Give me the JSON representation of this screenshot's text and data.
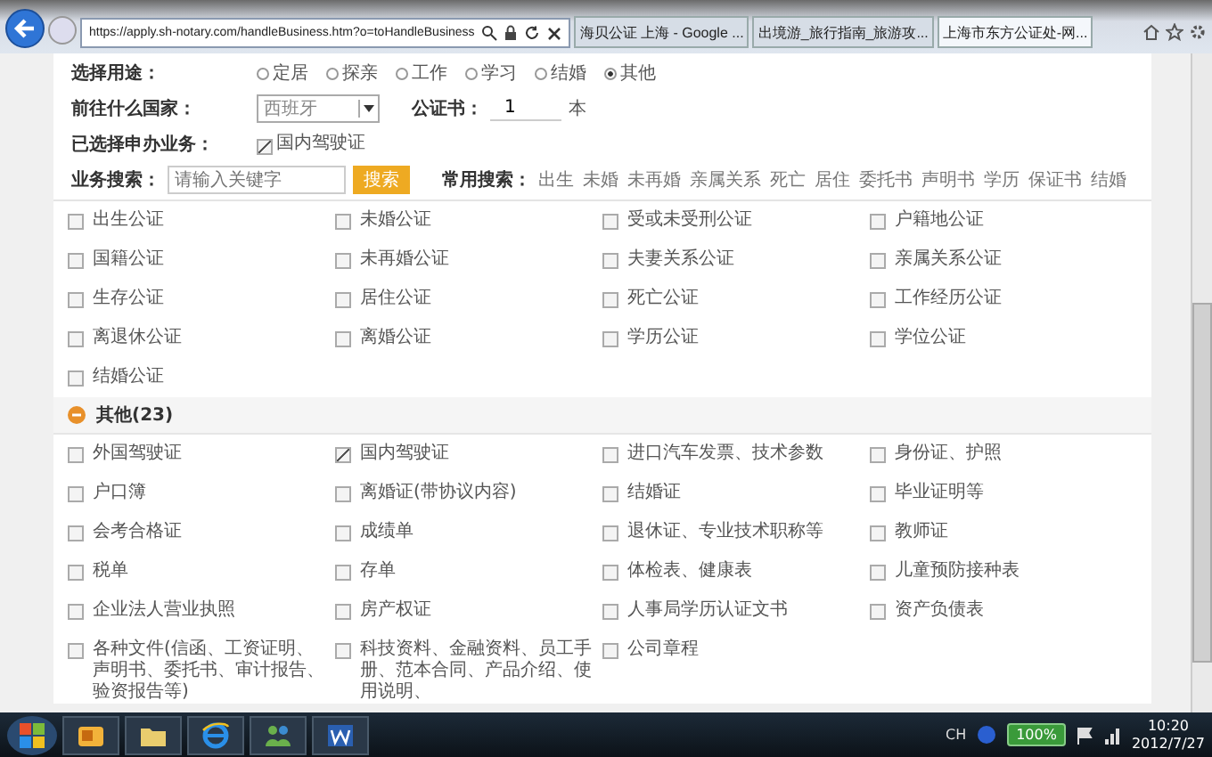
{
  "browser": {
    "address": "https://apply.sh-notary.com/handleBusiness.htm?o=toHandleBusiness",
    "tabs": [
      {
        "label": "海贝公证 上海 - Google ...",
        "selected": false
      },
      {
        "label": "出境游_旅行指南_旅游攻...",
        "selected": false
      },
      {
        "label": "上海市东方公证处-网...",
        "selected": true
      }
    ]
  },
  "form": {
    "purpose": {
      "label": "选择用途：",
      "options": [
        {
          "label": "定居",
          "selected": false
        },
        {
          "label": "探亲",
          "selected": false
        },
        {
          "label": "工作",
          "selected": false
        },
        {
          "label": "学习",
          "selected": false
        },
        {
          "label": "结婚",
          "selected": false
        },
        {
          "label": "其他",
          "selected": true
        }
      ]
    },
    "country": {
      "label": "前往什么国家：",
      "value": "西班牙"
    },
    "copies": {
      "label": "公证书：",
      "value": "1",
      "unit": "本"
    },
    "selected_services": {
      "label": "已选择申办业务：",
      "items": [
        {
          "label": "国内驾驶证",
          "checked": true
        }
      ]
    },
    "search": {
      "label": "业务搜索：",
      "placeholder": "请输入关键字",
      "button": "搜索",
      "common_label": "常用搜索：",
      "common_terms": [
        "出生",
        "未婚",
        "未再婚",
        "亲属关系",
        "死亡",
        "居住",
        "委托书",
        "声明书",
        "学历",
        "保证书",
        "结婚"
      ]
    }
  },
  "notary_items": [
    {
      "label": "出生公证",
      "checked": false
    },
    {
      "label": "未婚公证",
      "checked": false
    },
    {
      "label": "受或未受刑公证",
      "checked": false
    },
    {
      "label": "户籍地公证",
      "checked": false
    },
    {
      "label": "国籍公证",
      "checked": false
    },
    {
      "label": "未再婚公证",
      "checked": false
    },
    {
      "label": "夫妻关系公证",
      "checked": false
    },
    {
      "label": "亲属关系公证",
      "checked": false
    },
    {
      "label": "生存公证",
      "checked": false
    },
    {
      "label": "居住公证",
      "checked": false
    },
    {
      "label": "死亡公证",
      "checked": false
    },
    {
      "label": "工作经历公证",
      "checked": false
    },
    {
      "label": "离退休公证",
      "checked": false
    },
    {
      "label": "离婚公证",
      "checked": false
    },
    {
      "label": "学历公证",
      "checked": false
    },
    {
      "label": "学位公证",
      "checked": false
    },
    {
      "label": "结婚公证",
      "checked": false
    }
  ],
  "other_section": {
    "title": "其他(23)",
    "expanded": true,
    "items": [
      {
        "label": "外国驾驶证",
        "checked": false
      },
      {
        "label": "国内驾驶证",
        "checked": true
      },
      {
        "label": "进口汽车发票、技术参数",
        "checked": false
      },
      {
        "label": "身份证、护照",
        "checked": false
      },
      {
        "label": "户口簿",
        "checked": false
      },
      {
        "label": "离婚证(带协议内容)",
        "checked": false
      },
      {
        "label": "结婚证",
        "checked": false
      },
      {
        "label": "毕业证明等",
        "checked": false
      },
      {
        "label": "会考合格证",
        "checked": false
      },
      {
        "label": "成绩单",
        "checked": false
      },
      {
        "label": "退休证、专业技术职称等",
        "checked": false
      },
      {
        "label": "教师证",
        "checked": false
      },
      {
        "label": "税单",
        "checked": false
      },
      {
        "label": "存单",
        "checked": false
      },
      {
        "label": "体检表、健康表",
        "checked": false
      },
      {
        "label": "儿童预防接种表",
        "checked": false
      },
      {
        "label": "企业法人营业执照",
        "checked": false
      },
      {
        "label": "房产权证",
        "checked": false
      },
      {
        "label": "人事局学历认证文书",
        "checked": false
      },
      {
        "label": "资产负债表",
        "checked": false
      },
      {
        "label": "各种文件(信函、工资证明、声明书、委托书、审计报告、验资报告等)",
        "checked": false
      },
      {
        "label": "科技资料、金融资料、员工手册、范本合同、产品介绍、使用说明、",
        "checked": false
      },
      {
        "label": "公司章程",
        "checked": false
      }
    ]
  },
  "taskbar": {
    "language": "CH",
    "battery": "100%",
    "time": "10:20",
    "date": "2012/7/27"
  }
}
